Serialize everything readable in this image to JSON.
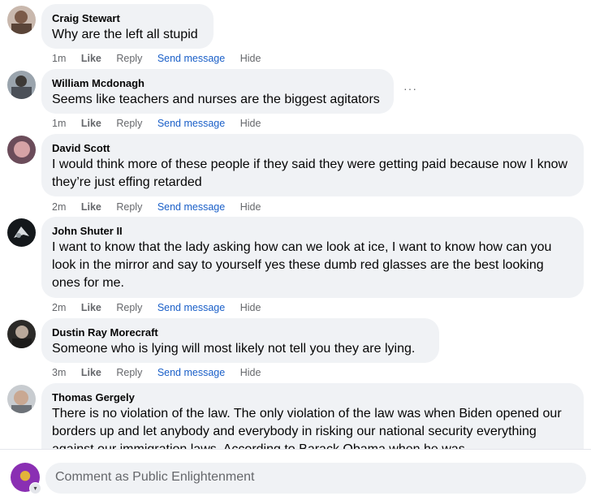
{
  "comments": [
    {
      "author": "Craig Stewart",
      "text": "Why are the left all stupid",
      "time": "1m",
      "avatar_color": "#8b6a5a",
      "actions": {
        "like": "Like",
        "reply": "Reply",
        "send": "Send message",
        "hide": "Hide"
      }
    },
    {
      "author": "William Mcdonagh",
      "text": "Seems like teachers and nurses are the biggest agitators",
      "time": "1m",
      "avatar_color": "#7d8a96",
      "actions": {
        "like": "Like",
        "reply": "Reply",
        "send": "Send message",
        "hide": "Hide"
      }
    },
    {
      "author": "David Scott",
      "text": "I would think more of these people if they said they were getting paid because now I know they’re just effing retarded",
      "time": "2m",
      "avatar_color": "#b07a80",
      "actions": {
        "like": "Like",
        "reply": "Reply",
        "send": "Send message",
        "hide": "Hide"
      }
    },
    {
      "author": "John Shuter II",
      "text": "I want to know that the lady asking how can we look at ice, I want to know how can you look in the mirror and say to yourself yes these dumb red glasses are the best looking ones for me.",
      "time": "2m",
      "avatar_color": "#1e2428",
      "actions": {
        "like": "Like",
        "reply": "Reply",
        "send": "Send message",
        "hide": "Hide"
      }
    },
    {
      "author": "Dustin Ray Morecraft",
      "text": "Someone who is lying will most likely not tell you they are lying.",
      "time": "3m",
      "avatar_color": "#3b3a38",
      "actions": {
        "like": "Like",
        "reply": "Reply",
        "send": "Send message",
        "hide": "Hide"
      }
    },
    {
      "author": "Thomas Gergely",
      "text": "There is no violation of the law. The only violation of the law was when Biden opened our borders up and let anybody and everybody in risking our national security everything against our immigration laws. According to Barack Obama when he was",
      "avatar_color": "#a7a7a3"
    }
  ],
  "more_options": "···",
  "composer": {
    "placeholder": "Comment as Public Enlightenment",
    "badge_icon": "chevron-down-icon"
  }
}
